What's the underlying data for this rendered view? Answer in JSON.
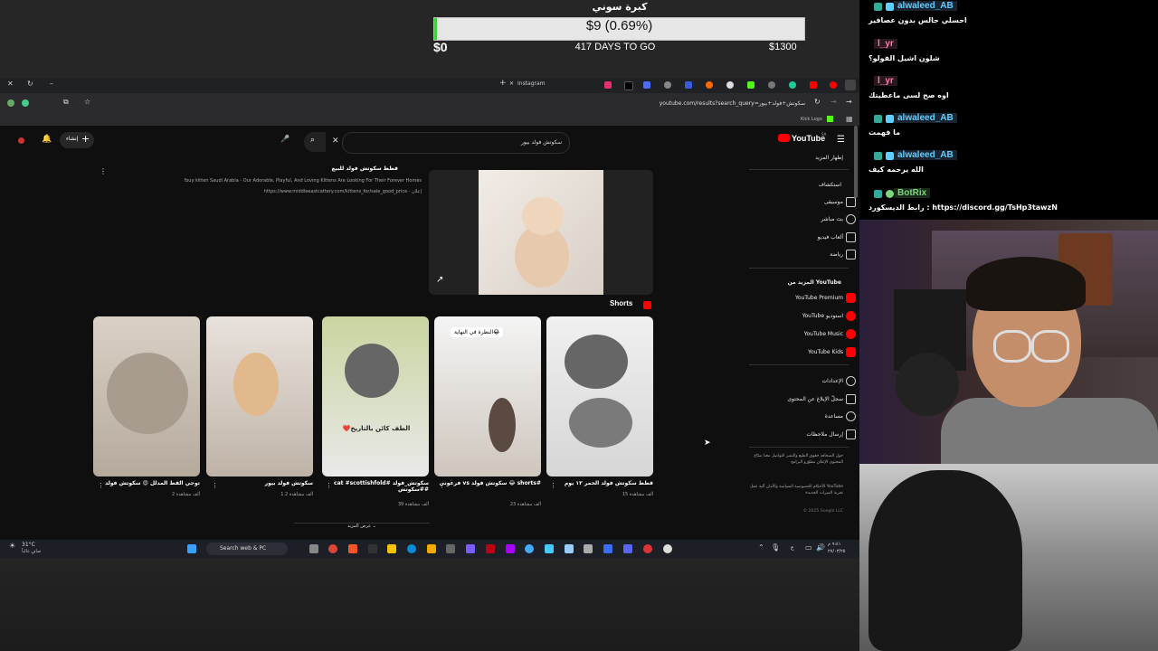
{
  "donation": {
    "title": "كبرة سوني",
    "amount": "$9 (0.69%)",
    "progress_percent": 0.69,
    "min": "$0",
    "days": "417 DAYS TO GO",
    "max": "$1300"
  },
  "browser": {
    "tab_label": "Instagram",
    "url": "youtube.com/results?search_query=سكوتش+فولد+بيور",
    "bookmark": "Kick Logo"
  },
  "youtube": {
    "logo": "YouTube",
    "logo_sup": "SA",
    "search_query": "سكوتش فولد بيور",
    "create_label": "إنشاء",
    "sidebar": {
      "show_more": "إظهار المزيد",
      "explore": "استكشاف",
      "explore_items": [
        "موسيقى",
        "بث مباشر",
        "ألعاب فيديو",
        "رياضة"
      ],
      "more_from": "المزيد من YouTube",
      "more_items": [
        "YouTube Premium",
        "YouTube استوديو",
        "YouTube Music",
        "YouTube Kids"
      ],
      "settings_items": [
        "الإعدادات",
        "سجلّ الإبلاغ عن المحتوى",
        "مساعدة",
        "إرسال ملاحظات"
      ],
      "footer1": "حول  الصحافة  حقوق الطبع والنشر  التواصل معنا  صنّاع المحتوى  الإعلان  مطوّرو البرامج",
      "footer2": "الأحكام  الخصوصية  السياسة والأمان  آلية عمل YouTube  تجربة الميزات الجديدة",
      "copyright": "© 2025 Google LLC"
    },
    "ad": {
      "title": "قطط سكوتش فولد للبيع",
      "desc": "!buy kitten Saudi Arabia - Our Adorable, Playful, And Loving Kittens Are Looking For Their Forever Homes",
      "url": "https://www.middleeastcattery.com/kittens_for/sale_good_price · إعلان"
    },
    "shorts_heading": "Shorts",
    "shorts": [
      {
        "title": "قطط سكوتش فولد الحمر ١٢ يوم",
        "views": "15 ألف مشاهدة",
        "overlay": ""
      },
      {
        "title": "فرعوني vs سكوتش فولد 😂 shorts#",
        "views": "23 ألف مشاهدة",
        "overlay": "النظرة في النهاية😂"
      },
      {
        "title": "cat #scottishfold# سكوتش_فولد #سكوتش#",
        "views": "39 ألف مشاهدة",
        "overlay": "❤️الطف كائن بالتاريخ"
      },
      {
        "title": "سكوتش فولد بيور",
        "views": "1.2 ألف مشاهدة",
        "overlay": ""
      },
      {
        "title": "توجي القط المدلل 😍 سكوتش فولد",
        "views": "2 ألف مشاهدة",
        "overlay": ""
      }
    ],
    "show_more_btn": "عرض المزيد"
  },
  "taskbar": {
    "weather": "31°C",
    "weather_desc": "صافٍ غالباً",
    "search": "Search web & PC",
    "time": "٩:٤١ م",
    "date": "٢٧/٠٣/٢٥",
    "lang": "ع"
  },
  "chat": [
    {
      "user": "alwaleed_AB",
      "color": "#5dd0ff",
      "msg": "احسلي جالس بدون عصافير"
    },
    {
      "user": "l_yr",
      "color": "#ff7aa8",
      "msg": "شلون اشيل الفولو؟"
    },
    {
      "user": "l_yr",
      "color": "#ff7aa8",
      "msg": "اوه صح لسى ماعطيتك"
    },
    {
      "user": "alwaleed_AB",
      "color": "#5dd0ff",
      "msg": "ما فهمت"
    },
    {
      "user": "alwaleed_AB",
      "color": "#5dd0ff",
      "msg": "الله يرحمه كيف"
    },
    {
      "user": "BotRix",
      "color": "#7cd67c",
      "msg": "رابط الديسكورد : https://discord.gg/TsHp3tawzN"
    }
  ]
}
